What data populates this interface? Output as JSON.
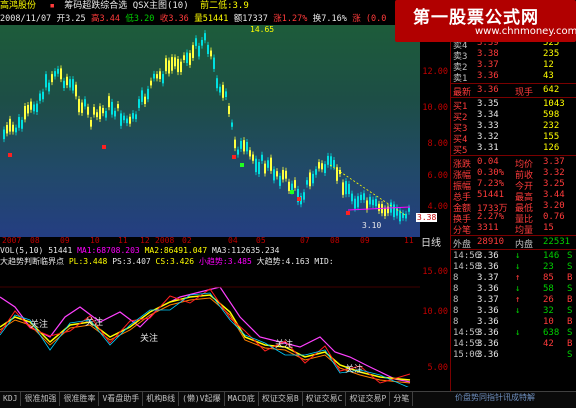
{
  "colors": {
    "up": "#ff3b3b",
    "down": "#00d000",
    "accent": "#b10000",
    "bg": "#000000"
  },
  "topbar": {
    "stock_name": "高鸿股份",
    "indicator": "筹码超跌综合选 QSX主图(10)",
    "prev_low_label": "前二低:3.9"
  },
  "infobar": {
    "date": "2008/11/07",
    "open": "开3.25",
    "high": "高3.44",
    "low": "低3.20",
    "close": "收3.36",
    "vol": "量51441",
    "amt": "额17337",
    "change": "涨1.27%",
    "turnover": "换7.16%",
    "rise": "涨 (0.0"
  },
  "main_chart": {
    "y_labels": [
      "12.00",
      "10.00",
      "8.00",
      "6.00",
      "4.00"
    ],
    "current_price": "3.38",
    "high_marker": "14.65",
    "low_marker": "3.10",
    "dates": [
      "2007",
      "08",
      "09",
      "10",
      "11",
      "12",
      "2008",
      "02",
      "04",
      "05",
      "07",
      "08",
      "09",
      "11"
    ],
    "period": "日线"
  },
  "vol_row": {
    "label": "VOL(5,10)",
    "v": "51441",
    "ma1": "MA1:68708.203",
    "ma2": "MA2:86491.047",
    "ma3": "MA3:112635.234"
  },
  "sub_title": {
    "name": "大趋势判断临界点",
    "pl": "PL:3.448",
    "ps": "PS:3.407",
    "cs": "CS:3.426",
    "small": "小趋势:3.485",
    "big": "大趋势:4.163",
    "mid": "MID:"
  },
  "sub_chart": {
    "y_labels": [
      "15.00",
      "10.00",
      "5.00"
    ],
    "labels": [
      "关注",
      "关注",
      "关注",
      "关注",
      "关注"
    ]
  },
  "tabs": [
    "KDJ",
    "很准加强",
    "很准胜率",
    "V看盘助手",
    "机构B线",
    "(懒)V起爆",
    "MACD底",
    "权证交易B",
    "权证交易C",
    "权证交易P",
    "分笔"
  ],
  "quote": {
    "sell": [
      {
        "l": "卖5",
        "p": "3.40",
        "v": "1045"
      },
      {
        "l": "卖4",
        "p": "3.39",
        "v": "525"
      },
      {
        "l": "卖3",
        "p": "3.38",
        "v": "235"
      },
      {
        "l": "卖2",
        "p": "3.37",
        "v": "12"
      },
      {
        "l": "卖1",
        "p": "3.36",
        "v": "43"
      }
    ],
    "last": {
      "l": "最新",
      "p": "3.36",
      "t": "现手",
      "v": "642"
    },
    "buy": [
      {
        "l": "买1",
        "p": "3.35",
        "v": "1043"
      },
      {
        "l": "买2",
        "p": "3.34",
        "v": "598"
      },
      {
        "l": "买3",
        "p": "3.33",
        "v": "232"
      },
      {
        "l": "买4",
        "p": "3.32",
        "v": "155"
      },
      {
        "l": "买5",
        "p": "3.31",
        "v": "126"
      }
    ],
    "stats": [
      {
        "a": "涨跌",
        "b": "0.04",
        "c": "均价",
        "d": "3.37"
      },
      {
        "a": "涨幅",
        "b": "0.30%",
        "c": "前收",
        "d": "3.32"
      },
      {
        "a": "振幅",
        "b": "7.23%",
        "c": "今开",
        "d": "3.25"
      },
      {
        "a": "总手",
        "b": "51441",
        "c": "最高",
        "d": "3.44"
      },
      {
        "a": "金额",
        "b": "1733万",
        "c": "最低",
        "d": "3.20"
      },
      {
        "a": "换手",
        "b": "2.27%",
        "c": "量比",
        "d": "0.76"
      },
      {
        "a": "分笔",
        "b": "3311",
        "c": "均量",
        "d": "15"
      }
    ],
    "outer": {
      "l": "外盘",
      "v": "28910",
      "l2": "内盘",
      "v2": "22531"
    },
    "ticks": [
      {
        "t": "14:56",
        "p": "3.36",
        "d": "↓",
        "v": "146",
        "s": "S"
      },
      {
        "t": "14:58",
        "p": "3.36",
        "d": "↓",
        "v": "23",
        "s": "S"
      },
      {
        "t": "8",
        "p": "3.37",
        "d": "↑",
        "v": "85",
        "s": "B"
      },
      {
        "t": "8",
        "p": "3.36",
        "d": "↓",
        "v": "58",
        "s": "S"
      },
      {
        "t": "8",
        "p": "3.37",
        "d": "↑",
        "v": "26",
        "s": "B"
      },
      {
        "t": "8",
        "p": "3.36",
        "d": "↓",
        "v": "32",
        "s": "S"
      },
      {
        "t": "8",
        "p": "3.36",
        "d": "",
        "v": "10",
        "s": "B"
      },
      {
        "t": "14:59",
        "p": "3.36",
        "d": "↓",
        "v": "638",
        "s": "S"
      },
      {
        "t": "14:59",
        "p": "3.36",
        "d": "",
        "v": "42",
        "s": "B"
      },
      {
        "t": "15:00",
        "p": "3.36",
        "d": "",
        "v": "",
        "s": "S"
      }
    ]
  },
  "watermark": {
    "title": "第一股票公式网",
    "url": "www.chnmoney.com",
    "bottom": "价盘势同指针讯成特解"
  }
}
